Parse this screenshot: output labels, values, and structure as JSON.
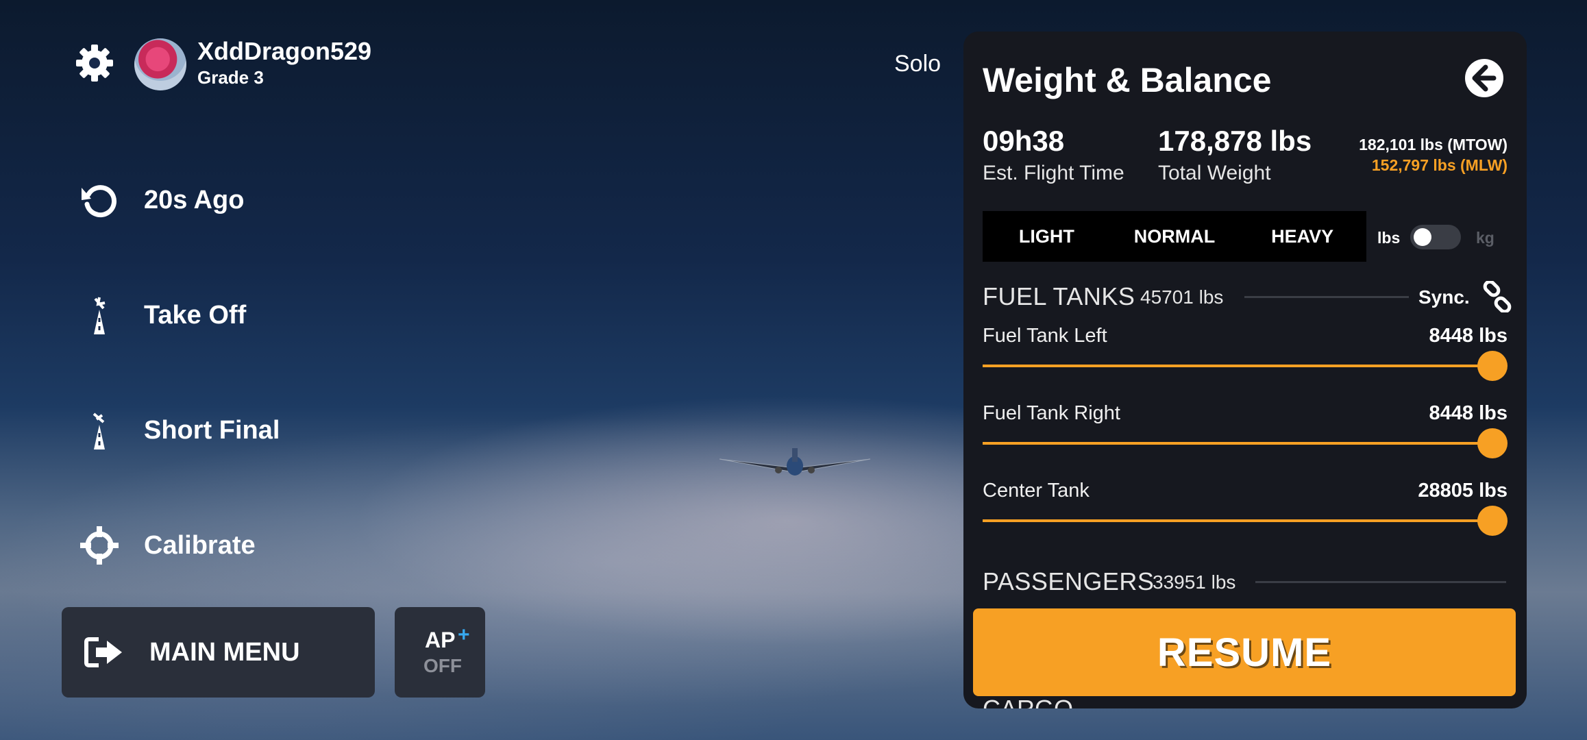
{
  "profile": {
    "username": "XddDragon529",
    "grade": "Grade 3"
  },
  "mode": "Solo",
  "menu": {
    "items": [
      {
        "label": "20s Ago",
        "icon": "rewind-icon"
      },
      {
        "label": "Take Off",
        "icon": "runway-takeoff-icon"
      },
      {
        "label": "Short Final",
        "icon": "runway-landing-icon"
      },
      {
        "label": "Calibrate",
        "icon": "crosshair-icon"
      }
    ],
    "main_menu": "MAIN MENU",
    "ap_label": "AP",
    "ap_plus": "+",
    "ap_state": "OFF"
  },
  "panel": {
    "title": "Weight & Balance",
    "flight_time": "09h38",
    "flight_time_label": "Est. Flight Time",
    "total_weight": "178,878 lbs",
    "total_weight_label": "Total Weight",
    "mtow": "182,101 lbs (MTOW)",
    "mlw": "152,797 lbs (MLW)",
    "presets": [
      "LIGHT",
      "NORMAL",
      "HEAVY"
    ],
    "unit_lbs": "lbs",
    "unit_kg": "kg",
    "unit_selected": "lbs",
    "fuel": {
      "title": "FUEL TANKS",
      "total": "45701 lbs",
      "sync": "Sync.",
      "tanks": [
        {
          "name": "Fuel Tank Left",
          "value": "8448 lbs",
          "fill": 1.0
        },
        {
          "name": "Fuel Tank Right",
          "value": "8448 lbs",
          "fill": 1.0
        },
        {
          "name": "Center Tank",
          "value": "28805 lbs",
          "fill": 1.0
        }
      ]
    },
    "passengers": {
      "title": "PASSENGERS",
      "total": "33951 lbs"
    },
    "cargo": {
      "title": "CARGO"
    },
    "resume": "RESUME"
  },
  "colors": {
    "accent": "#f7a024",
    "panel": "#16181f",
    "button": "#2a2f3a",
    "ap_plus": "#37a9f0"
  }
}
